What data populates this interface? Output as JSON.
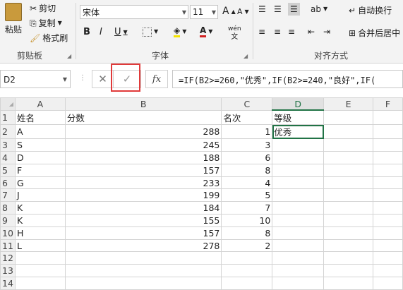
{
  "ribbon": {
    "clipboard": {
      "paste": "粘贴",
      "cut": "剪切",
      "copy": "复制",
      "format_painter": "格式刷",
      "group": "剪贴板"
    },
    "font": {
      "name": "宋体",
      "size": "11",
      "bold": "B",
      "italic": "I",
      "underline": "U",
      "grow": "A",
      "shrink": "A",
      "wen": "wén",
      "group": "字体"
    },
    "alignment": {
      "wrap": "自动换行",
      "merge": "合并后居中",
      "group": "对齐方式"
    }
  },
  "formula": {
    "name_box": "D2",
    "cancel": "✕",
    "enter": "✓",
    "fx": "fx",
    "content": "=IF(B2>=260,\"优秀\",IF(B2>=240,\"良好\",IF("
  },
  "sheet": {
    "columns": [
      "A",
      "B",
      "C",
      "D",
      "E",
      "F"
    ],
    "rows": [
      {
        "n": "1",
        "a": "姓名",
        "b": "分数",
        "c": "名次",
        "d": "等级"
      },
      {
        "n": "2",
        "a": "A",
        "b": "288",
        "c": "1",
        "d": "优秀"
      },
      {
        "n": "3",
        "a": "S",
        "b": "245",
        "c": "3",
        "d": ""
      },
      {
        "n": "4",
        "a": "D",
        "b": "188",
        "c": "6",
        "d": ""
      },
      {
        "n": "5",
        "a": "F",
        "b": "157",
        "c": "8",
        "d": ""
      },
      {
        "n": "6",
        "a": "G",
        "b": "233",
        "c": "4",
        "d": ""
      },
      {
        "n": "7",
        "a": "J",
        "b": "199",
        "c": "5",
        "d": ""
      },
      {
        "n": "8",
        "a": "K",
        "b": "184",
        "c": "7",
        "d": ""
      },
      {
        "n": "9",
        "a": "K",
        "b": "155",
        "c": "10",
        "d": ""
      },
      {
        "n": "10",
        "a": "H",
        "b": "157",
        "c": "8",
        "d": ""
      },
      {
        "n": "11",
        "a": "L",
        "b": "278",
        "c": "2",
        "d": ""
      },
      {
        "n": "12",
        "a": "",
        "b": "",
        "c": "",
        "d": ""
      },
      {
        "n": "13",
        "a": "",
        "b": "",
        "c": "",
        "d": ""
      },
      {
        "n": "14",
        "a": "",
        "b": "",
        "c": "",
        "d": ""
      }
    ]
  },
  "colors": {
    "accent": "#217346",
    "highlight": "#e03a3a"
  }
}
